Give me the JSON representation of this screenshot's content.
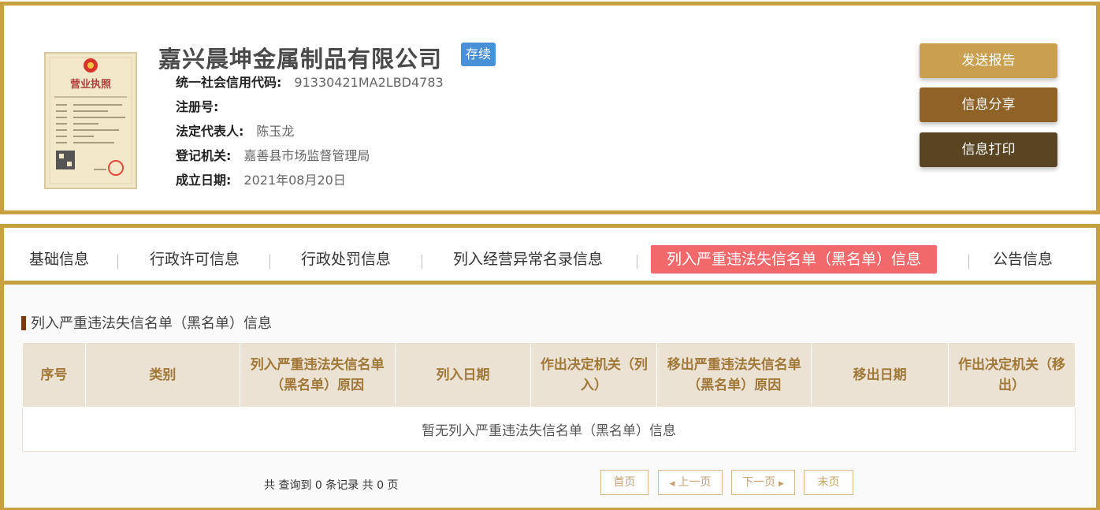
{
  "company": {
    "name": "嘉兴晨坤金属制品有限公司",
    "status": "存续",
    "fields": [
      {
        "label": "统一社会信用代码:",
        "value": "91330421MA2LBD4783"
      },
      {
        "label": "注册号:",
        "value": ""
      },
      {
        "label": "法定代表人:",
        "value": "陈玉龙"
      },
      {
        "label": "登记机关:",
        "value": "嘉善县市场监督管理局"
      },
      {
        "label": "成立日期:",
        "value": "2021年08月20日"
      }
    ],
    "license_title": "营业执照"
  },
  "actions": {
    "send_report": "发送报告",
    "share": "信息分享",
    "print": "信息打印"
  },
  "tabs": [
    {
      "label": "基础信息",
      "active": false
    },
    {
      "label": "行政许可信息",
      "active": false
    },
    {
      "label": "行政处罚信息",
      "active": false
    },
    {
      "label": "列入经营异常名录信息",
      "active": false
    },
    {
      "label": "列入严重违法失信名单（黑名单）信息",
      "active": true
    },
    {
      "label": "公告信息",
      "active": false
    }
  ],
  "section": {
    "title": "列入严重违法失信名单（黑名单）信息"
  },
  "table": {
    "headers": [
      "序号",
      "类别",
      "列入严重违法失信名单（黑名单）原因",
      "列入日期",
      "作出决定机关（列入）",
      "移出严重违法失信名单（黑名单）原因",
      "移出日期",
      "作出决定机关（移出）"
    ],
    "empty_text": "暂无列入严重违法失信名单（黑名单）信息"
  },
  "pagination": {
    "summary": "共 查询到 0 条记录 共 0 页",
    "first": "首页",
    "prev": "上一页",
    "next": "下一页",
    "last": "末页"
  },
  "colors": {
    "border": "#c9a040",
    "status_badge": "#4a90d9",
    "active_tab": "#f2696b",
    "btn_report": "#c8a050",
    "btn_share": "#8f6227",
    "btn_print": "#5a4522"
  }
}
